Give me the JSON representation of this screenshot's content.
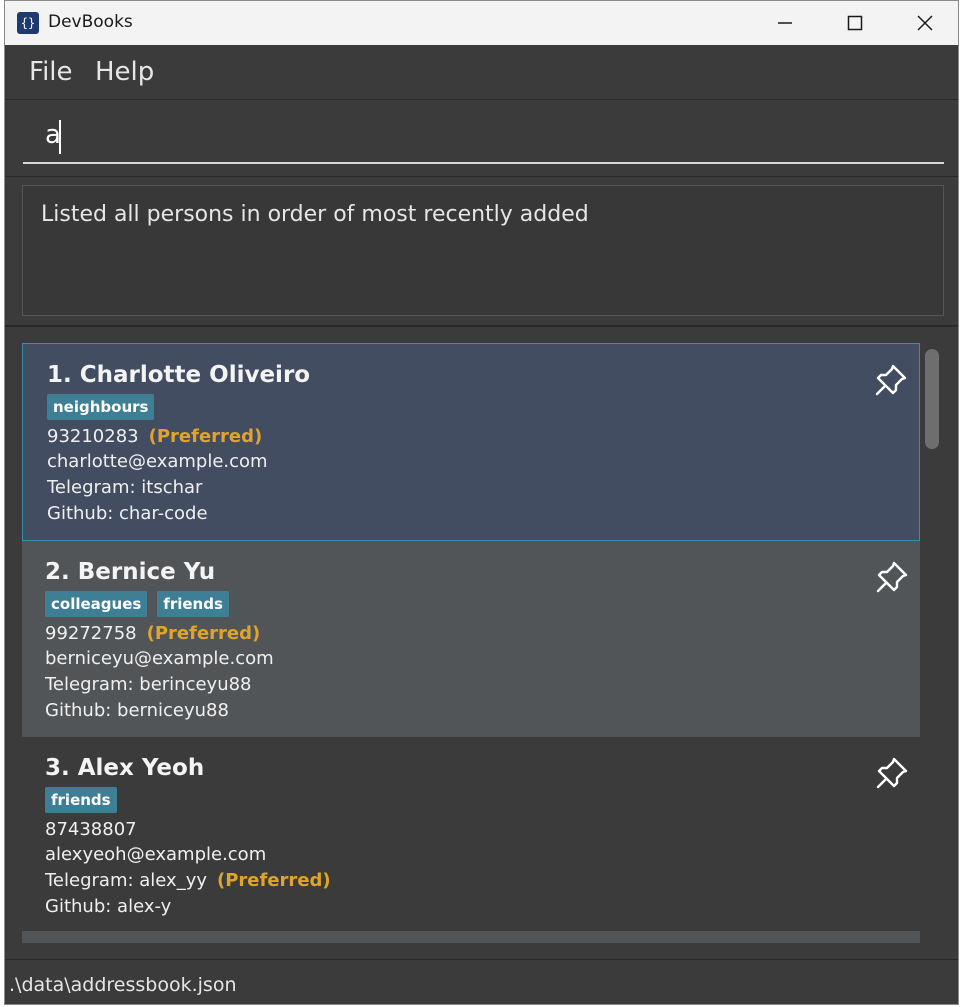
{
  "window": {
    "title": "DevBooks",
    "icon": "book-icon",
    "controls": [
      "minimize-icon",
      "maximize-icon",
      "close-icon"
    ]
  },
  "menu": {
    "file": "File",
    "help": "Help"
  },
  "command": {
    "value": "a",
    "placeholder": ""
  },
  "result": {
    "message": "Listed all persons in order of most recently added"
  },
  "persons": [
    {
      "index_name": "1. Charlotte Oliveiro",
      "tags": [
        "neighbours"
      ],
      "phone": "93210283",
      "phone_pref": "(Preferred)",
      "email": "charlotte@example.com",
      "telegram": "Telegram: itschar",
      "telegram_pref": "",
      "github": "Github: char-code",
      "pin_icon": "pin-icon"
    },
    {
      "index_name": "2. Bernice Yu",
      "tags": [
        "colleagues",
        "friends"
      ],
      "phone": "99272758",
      "phone_pref": "(Preferred)",
      "email": "berniceyu@example.com",
      "telegram": "Telegram: berinceyu88",
      "telegram_pref": "",
      "github": "Github: berniceyu88",
      "pin_icon": "pin-icon"
    },
    {
      "index_name": "3. Alex Yeoh",
      "tags": [
        "friends"
      ],
      "phone": "87438807",
      "phone_pref": "",
      "email": "alexyeoh@example.com",
      "telegram": "Telegram: alex_yy",
      "telegram_pref": "(Preferred)",
      "github": "Github: alex-y",
      "pin_icon": "pin-icon"
    }
  ],
  "status": {
    "path": ".\\data\\addressbook.json"
  },
  "colors": {
    "background": "#3b3b3b",
    "selected_card": "#434d61",
    "alt_card": "#525558",
    "tag": "#3f7f96",
    "preferred": "#e0a42a"
  }
}
